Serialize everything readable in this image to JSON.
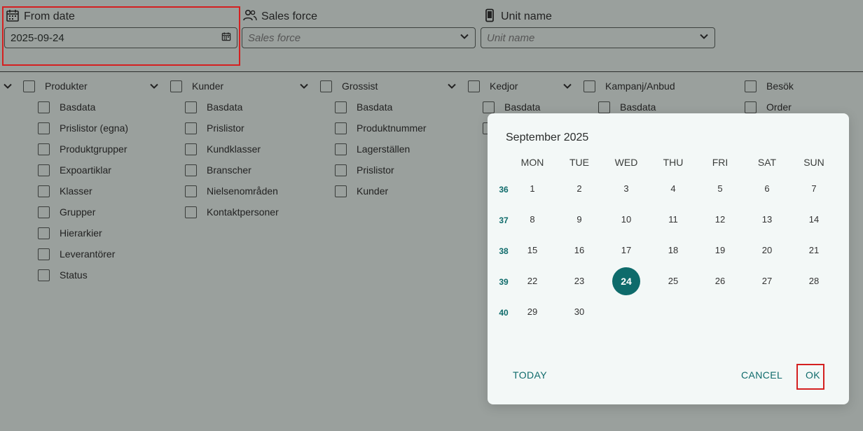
{
  "filters": {
    "from_date": {
      "label": "From date",
      "value": "2025-09-24"
    },
    "sales_force": {
      "label": "Sales force",
      "placeholder": "Sales force"
    },
    "unit_name": {
      "label": "Unit name",
      "placeholder": "Unit name"
    }
  },
  "groups": [
    {
      "label": "Produkter",
      "items": [
        "Basdata",
        "Prislistor (egna)",
        "Produktgrupper",
        "Expoartiklar",
        "Klasser",
        "Grupper",
        "Hierarkier",
        "Leverantörer",
        "Status"
      ]
    },
    {
      "label": "Kunder",
      "items": [
        "Basdata",
        "Prislistor",
        "Kundklasser",
        "Branscher",
        "Nielsenområden",
        "Kontaktpersoner"
      ]
    },
    {
      "label": "Grossist",
      "items": [
        "Basdata",
        "Produktnummer",
        "Lagerställen",
        "Prislistor",
        "Kunder"
      ]
    },
    {
      "label": "Kedjor",
      "items": [
        "Basdata"
      ]
    },
    {
      "label": "Kampanj/Anbud",
      "items": [
        "Basdata"
      ]
    },
    {
      "label": "Besök",
      "items": [
        "Order"
      ]
    }
  ],
  "calendar": {
    "month_title": "September 2025",
    "weekdays": [
      "MON",
      "TUE",
      "WED",
      "THU",
      "FRI",
      "SAT",
      "SUN"
    ],
    "weeks": [
      {
        "number": "36",
        "days": [
          "1",
          "2",
          "3",
          "4",
          "5",
          "6",
          "7"
        ]
      },
      {
        "number": "37",
        "days": [
          "8",
          "9",
          "10",
          "11",
          "12",
          "13",
          "14"
        ]
      },
      {
        "number": "38",
        "days": [
          "15",
          "16",
          "17",
          "18",
          "19",
          "20",
          "21"
        ]
      },
      {
        "number": "39",
        "days": [
          "22",
          "23",
          "24",
          "25",
          "26",
          "27",
          "28"
        ]
      },
      {
        "number": "40",
        "days": [
          "29",
          "30"
        ]
      }
    ],
    "selected_day": "24",
    "buttons": {
      "today": "TODAY",
      "cancel": "CANCEL",
      "ok": "OK"
    }
  },
  "colors": {
    "accent": "#0e6b6b",
    "highlight": "#d42020",
    "backdrop": "#9aa09d",
    "dialog_bg": "#f3f8f7"
  }
}
